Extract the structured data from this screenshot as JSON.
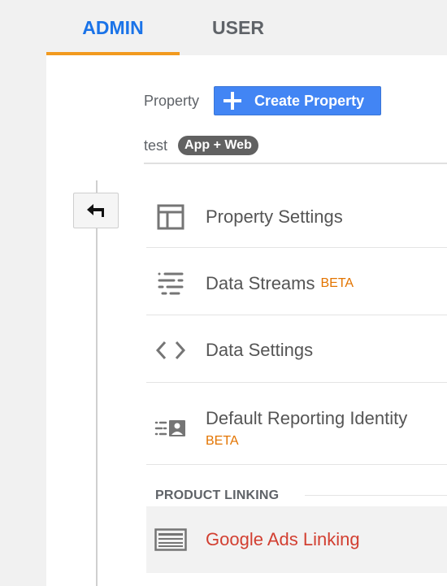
{
  "tabs": {
    "admin": "ADMIN",
    "user": "USER"
  },
  "property": {
    "label": "Property",
    "create_button": "Create Property",
    "name": "test",
    "type_badge": "App + Web"
  },
  "menu": {
    "items": [
      {
        "label": "Property Settings",
        "icon": "property-settings-icon",
        "beta": ""
      },
      {
        "label": "Data Streams",
        "icon": "data-streams-icon",
        "beta": "BETA"
      },
      {
        "label": "Data Settings",
        "icon": "code-brackets-icon",
        "beta": ""
      },
      {
        "label": "Default Reporting Identity",
        "icon": "reporting-identity-icon",
        "beta": "BETA"
      }
    ]
  },
  "product_linking": {
    "header": "PRODUCT LINKING",
    "items": [
      {
        "label": "Google Ads Linking",
        "icon": "google-ads-icon"
      }
    ]
  },
  "colors": {
    "accent": "#1a73e8",
    "tab_underline": "#f29a1f",
    "button": "#4285f4",
    "beta": "#e37400",
    "link_red": "#d23f31"
  }
}
